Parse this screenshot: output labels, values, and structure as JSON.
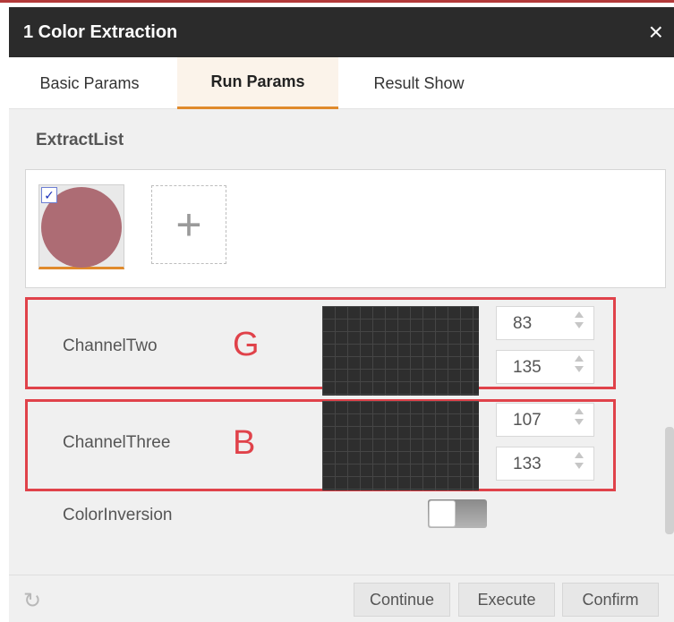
{
  "window": {
    "title": "1 Color Extraction",
    "close_icon": "×"
  },
  "tabs": [
    {
      "label": "Basic Params",
      "active": false
    },
    {
      "label": "Run Params",
      "active": true
    },
    {
      "label": "Result Show",
      "active": false
    }
  ],
  "extract_list": {
    "label": "ExtractList",
    "swatch_color": "#ad6c74",
    "checkbox_checked": true,
    "checkbox_mark": "✓",
    "add_icon": "+"
  },
  "channels": [
    {
      "label": "ChannelTwo",
      "annotation": "G",
      "min": "83",
      "max": "135"
    },
    {
      "label": "ChannelThree",
      "annotation": "B",
      "min": "107",
      "max": "133"
    }
  ],
  "color_inversion": {
    "label": "ColorInversion",
    "enabled": false
  },
  "footer": {
    "refresh_icon": "↻",
    "continue": "Continue",
    "execute": "Execute",
    "confirm": "Confirm"
  },
  "colors": {
    "accent": "#e08a2c",
    "highlight": "#e0424a",
    "titlebar": "#2b2b2b"
  }
}
